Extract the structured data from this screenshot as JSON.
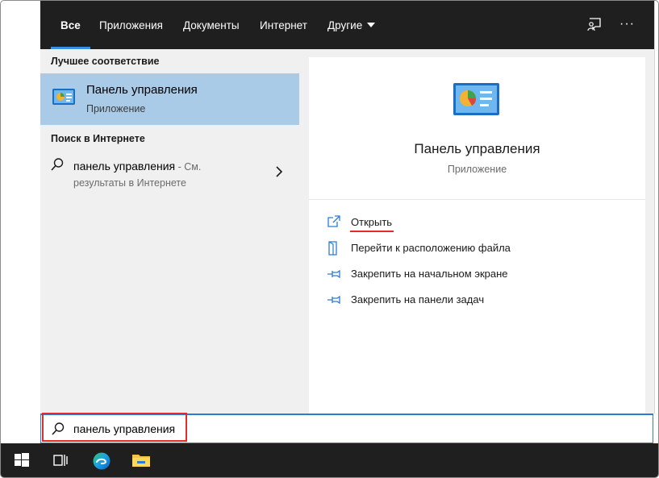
{
  "tabs": [
    {
      "label": "Все",
      "active": true
    },
    {
      "label": "Приложения"
    },
    {
      "label": "Документы"
    },
    {
      "label": "Интернет"
    },
    {
      "label": "Другие"
    }
  ],
  "top_icons": [
    "feedback-icon",
    "more-icon"
  ],
  "more_glyph": "···",
  "left": {
    "best_match_title": "Лучшее соответствие",
    "best_match": {
      "name": "Панель управления",
      "type": "Приложение",
      "icon": "control-panel-icon"
    },
    "web_title": "Поиск в Интернете",
    "web_result": {
      "query": "панель управления",
      "hint": " - См.",
      "hint2": "результаты в Интернете"
    }
  },
  "preview": {
    "title": "Панель управления",
    "subtitle": "Приложение",
    "actions": [
      {
        "label": "Открыть",
        "icon": "open-icon"
      },
      {
        "label": "Перейти к расположению файла",
        "icon": "file-location-icon"
      },
      {
        "label": "Закрепить на начальном экране",
        "icon": "pin-icon"
      },
      {
        "label": "Закрепить на панели задач",
        "icon": "pin-icon"
      }
    ]
  },
  "search": {
    "value": "панель управления"
  },
  "taskbar": [
    "windows-start-icon",
    "task-view-icon",
    "edge-icon",
    "file-explorer-icon"
  ],
  "colors": {
    "accent": "#2b7cd3",
    "highlight": "#a9cbe8",
    "annotation": "#e52a2a",
    "topbar": "#1f1f1f"
  }
}
